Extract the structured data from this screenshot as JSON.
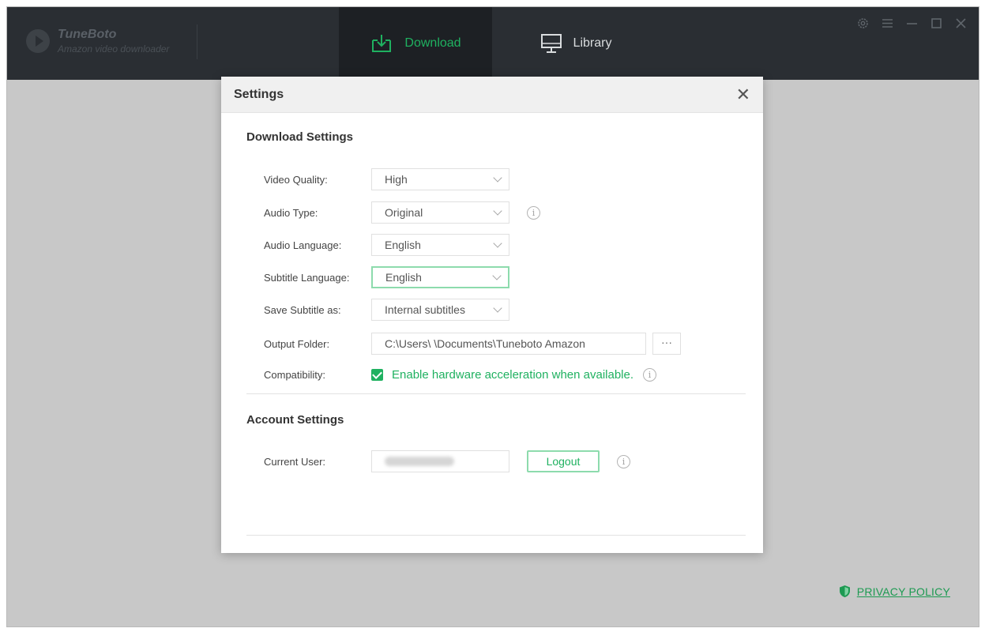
{
  "app": {
    "name": "TuneBoto",
    "subtitle": "Amazon video downloader"
  },
  "tabs": [
    {
      "label": "Download",
      "icon": "download-icon",
      "active": true
    },
    {
      "label": "Library",
      "icon": "monitor-icon",
      "active": false
    }
  ],
  "window_controls": [
    "gear-icon",
    "menu-icon",
    "minimize-icon",
    "maximize-icon",
    "close-icon"
  ],
  "colors": {
    "accent": "#1fb160",
    "topbar": "#2a2e33",
    "active_tab": "#1d2024",
    "background": "#c8c8c8"
  },
  "privacy": {
    "label": "PRIVACY POLICY"
  },
  "settings_dialog": {
    "title": "Settings",
    "download_settings": {
      "title": "Download Settings",
      "video_quality": {
        "label": "Video Quality:",
        "value": "High"
      },
      "audio_type": {
        "label": "Audio Type:",
        "value": "Original"
      },
      "audio_language": {
        "label": "Audio Language:",
        "value": "English"
      },
      "subtitle_language": {
        "label": "Subtitle Language:",
        "value": "English"
      },
      "save_subtitle": {
        "label": "Save Subtitle as:",
        "value": "Internal subtitles"
      },
      "output_folder": {
        "label": "Output Folder:",
        "value": "C:\\Users\\ \\Documents\\Tuneboto Amazon",
        "button": "···"
      },
      "compatibility": {
        "label": "Compatibility:",
        "checkbox_label": "Enable hardware acceleration when available.",
        "checked": true
      }
    },
    "account_settings": {
      "title": "Account Settings",
      "current_user": {
        "label": "Current User:",
        "logout": "Logout"
      }
    }
  }
}
